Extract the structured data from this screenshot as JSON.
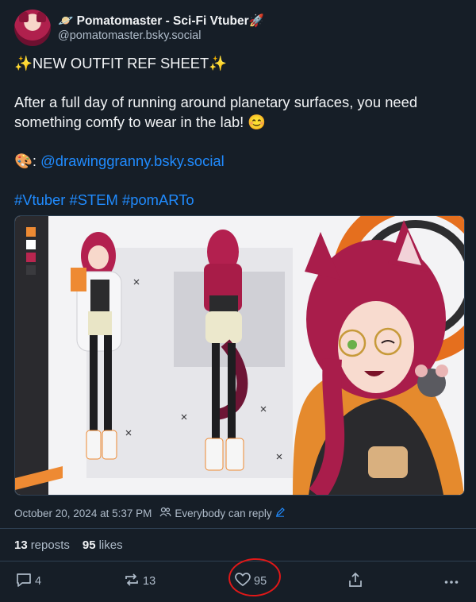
{
  "author": {
    "display_name": "🪐 Pomatomaster - Sci-Fi Vtuber🚀",
    "handle": "@pomatomaster.bsky.social"
  },
  "post": {
    "line1": "✨NEW OUTFIT REF SHEET✨",
    "line2": "After a full day of running around planetary surfaces, you need something comfy to wear in the lab! 😊",
    "artist_prefix": "🎨: ",
    "artist_link": "@drawinggranny.bsky.social",
    "tags": [
      "#Vtuber",
      "#STEM",
      "#pomARTo"
    ]
  },
  "meta": {
    "timestamp": "October 20, 2024 at 5:37 PM",
    "reply_setting": "Everybody can reply"
  },
  "stats": {
    "reposts_count": "13",
    "reposts_label": "reposts",
    "likes_count": "95",
    "likes_label": "likes"
  },
  "actions": {
    "replies": "4",
    "reposts": "13",
    "likes": "95"
  },
  "colors": {
    "background": "#161e27",
    "link": "#208bfe",
    "muted": "#aebbc9",
    "annotation_circle": "#e01818"
  },
  "icons": [
    "reply-icon",
    "repost-icon",
    "like-icon",
    "share-icon",
    "more-icon",
    "people-icon",
    "edit-icon"
  ]
}
